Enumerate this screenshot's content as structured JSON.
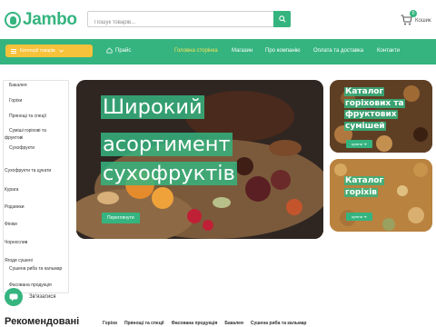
{
  "header": {
    "logo": "Jambo",
    "search_placeholder": "Пошук товарів...",
    "cart_count": "0",
    "cart_label": "Кошик"
  },
  "nav": {
    "catalog_button": "Категорії товарів",
    "items": [
      "Прайс",
      "Головна сторінка",
      "Магазин",
      "Про компанію",
      "Оплата та доставка",
      "Контакти"
    ],
    "active": "Головна сторінка"
  },
  "categories": [
    "Бакалея",
    "Горіхи",
    "Прянощі та спеції",
    "Суміші горіхові та фруктові",
    "Сухофрукти",
    "Сухофрукти та цукати",
    "Курага",
    "Родзинки",
    "Фініки",
    "Чорнослив",
    "Ягоди сушені",
    "Сушена риба та кальмар",
    "Фасована продукція"
  ],
  "hero": {
    "title_lines": [
      "Широкий",
      "асортимент",
      "сухофруктів"
    ],
    "cta": "Переглянути"
  },
  "side_banners": [
    {
      "title_lines": [
        "Каталог",
        "горіхових та",
        "фруктових",
        "сумішей"
      ],
      "cta": "купити"
    },
    {
      "title_lines": [
        "Каталог",
        "горіхів"
      ],
      "cta": "купити"
    }
  ],
  "chat_label": "Зв'язатися",
  "recommended": {
    "title": "Рекомендовані",
    "tabs": [
      "Горіхи",
      "Прянощі та спеції",
      "Фасована продукція",
      "Бакалея",
      "Сушена риба та кальмар"
    ]
  },
  "colors": {
    "brand_green": "#35b47f",
    "catalog_yellow": "#f7c23b"
  }
}
